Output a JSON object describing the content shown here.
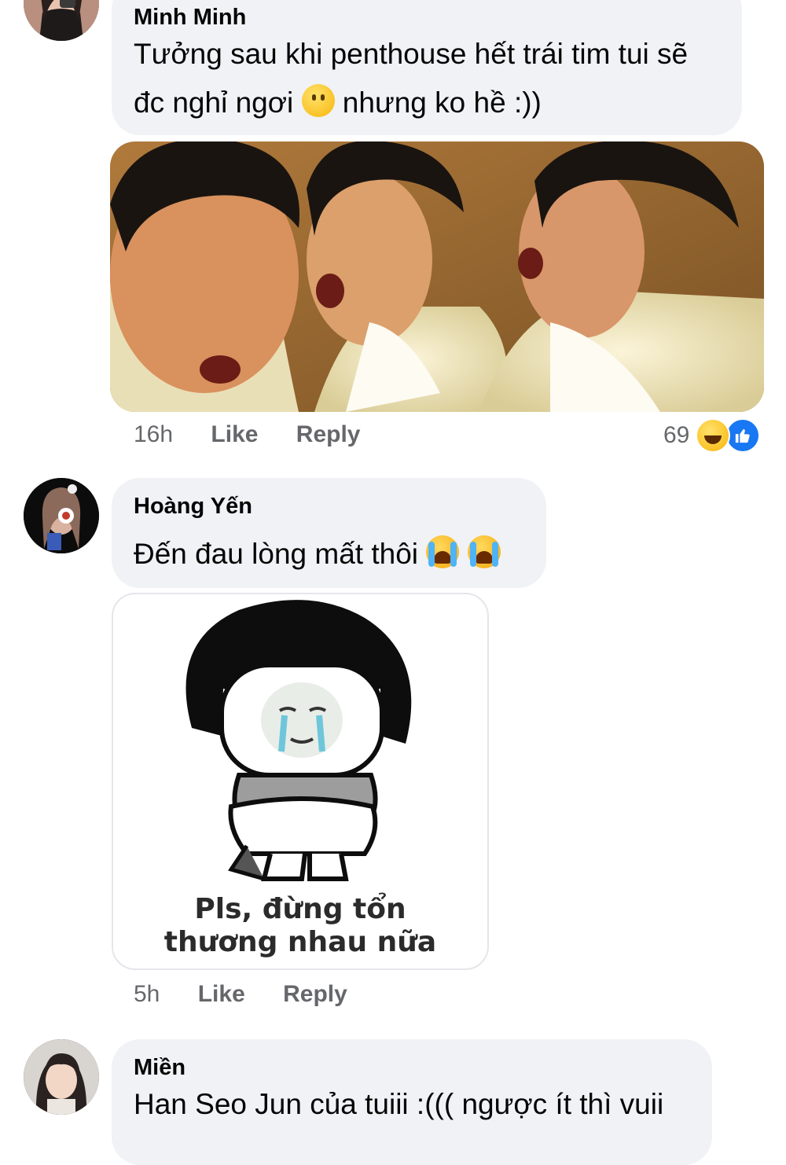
{
  "comments": [
    {
      "author": "Minh Minh",
      "text_line1": "Tưởng sau khi penthouse hết trái tim tui sẽ",
      "text_line2_a": "đc nghỉ ngơi",
      "text_line2_b": "nhưng ko hề :))",
      "time": "16h",
      "like_label": "Like",
      "reply_label": "Reply",
      "reaction_count": "69",
      "reaction_icons": [
        "haha-icon",
        "like-icon"
      ]
    },
    {
      "author": "Hoàng Yến",
      "text": "Đến đau lòng mất thôi",
      "sticker_caption_line1": "Pls, đừng tổn",
      "sticker_caption_line2": "thương nhau nữa",
      "time": "5h",
      "like_label": "Like",
      "reply_label": "Reply"
    },
    {
      "author": "Miền",
      "text": "Han Seo Jun của tuiii :((( ngược ít thì vuii"
    }
  ],
  "colors": {
    "bubble": "#f0f2f5",
    "meta_text": "#65676b",
    "like_blue": "#1877f2"
  }
}
